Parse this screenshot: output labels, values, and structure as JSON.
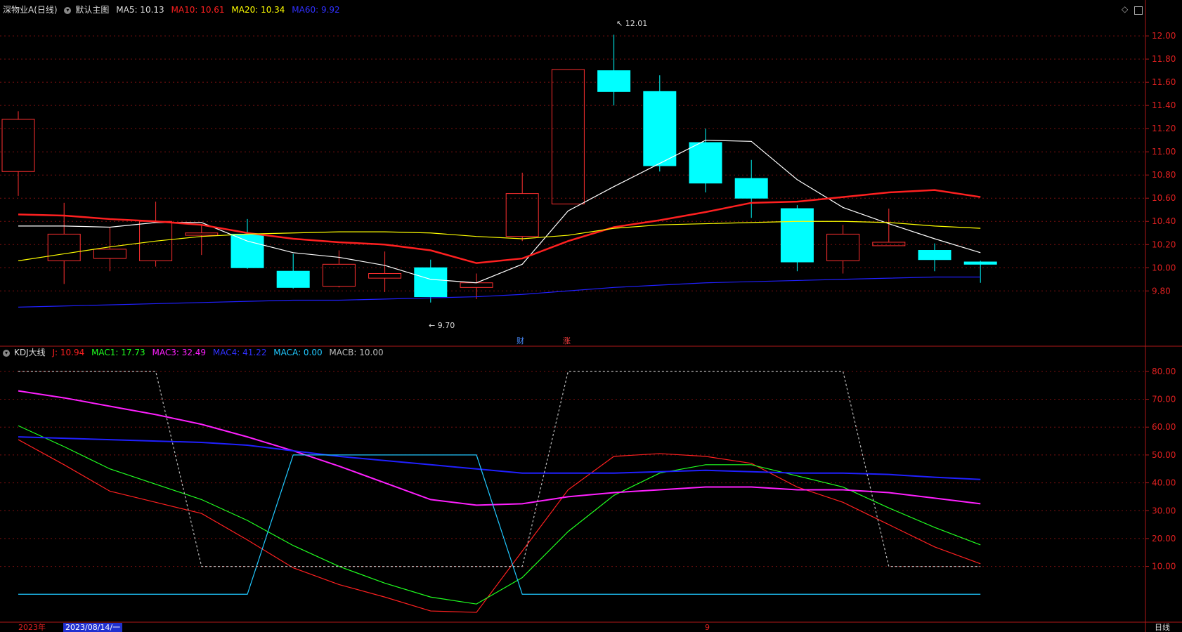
{
  "main_header": {
    "title": "深物业A(日线)",
    "template": "默认主图",
    "ma5": "MA5: 10.13",
    "ma10": "MA10: 10.61",
    "ma20": "MA20: 10.34",
    "ma60": "MA60: 9.92",
    "colors": {
      "ma5": "#ffffff",
      "ma10": "#ff2020",
      "ma20": "#ffff00",
      "ma60": "#2020ff"
    }
  },
  "kdj_header": {
    "title": "KDJ大线",
    "j": "J: 10.94",
    "mac1": "MAC1: 17.73",
    "mac3": "MAC3: 32.49",
    "mac4": "MAC4: 41.22",
    "maca": "MACA: 0.00",
    "macb": "MACB: 10.00"
  },
  "annotations": {
    "high": "12.01",
    "low": "9.70",
    "badge_finance": "财",
    "badge_rise": "涨"
  },
  "top_icons": [
    "diamond-icon",
    "window-icon"
  ],
  "x_axis": {
    "year": "2023年",
    "cursor_date": "2023/08/14/一",
    "month": "9",
    "period": "日线"
  },
  "chart_data": [
    {
      "type": "candlestick",
      "title": "深物业A(日线)",
      "y_ticks": [
        "12.00",
        "11.80",
        "11.60",
        "11.40",
        "11.20",
        "11.00",
        "10.80",
        "10.60",
        "10.40",
        "10.20",
        "10.00",
        "9.80"
      ],
      "ylim": [
        9.62,
        12.14
      ],
      "candles": [
        {
          "o": 10.83,
          "h": 11.35,
          "l": 10.62,
          "c": 11.28
        },
        {
          "o": 10.06,
          "h": 10.56,
          "l": 9.86,
          "c": 10.29
        },
        {
          "o": 10.08,
          "h": 10.35,
          "l": 9.97,
          "c": 10.16
        },
        {
          "o": 10.06,
          "h": 10.57,
          "l": 10.01,
          "c": 10.4
        },
        {
          "o": 10.28,
          "h": 10.37,
          "l": 10.11,
          "c": 10.3
        },
        {
          "o": 10.29,
          "h": 10.42,
          "l": 9.99,
          "c": 10.0
        },
        {
          "o": 9.97,
          "h": 10.12,
          "l": 9.82,
          "c": 9.83
        },
        {
          "o": 9.84,
          "h": 10.15,
          "l": 9.83,
          "c": 10.03
        },
        {
          "o": 9.91,
          "h": 10.14,
          "l": 9.79,
          "c": 9.95
        },
        {
          "o": 10.0,
          "h": 10.07,
          "l": 9.7,
          "c": 9.75
        },
        {
          "o": 9.83,
          "h": 9.95,
          "l": 9.73,
          "c": 9.87
        },
        {
          "o": 10.27,
          "h": 10.82,
          "l": 10.23,
          "c": 10.64
        },
        {
          "o": 10.55,
          "h": 11.71,
          "l": 10.55,
          "c": 11.71
        },
        {
          "o": 11.7,
          "h": 12.01,
          "l": 11.4,
          "c": 11.52
        },
        {
          "o": 11.52,
          "h": 11.66,
          "l": 10.83,
          "c": 10.88
        },
        {
          "o": 11.08,
          "h": 11.2,
          "l": 10.65,
          "c": 10.73
        },
        {
          "o": 10.77,
          "h": 10.93,
          "l": 10.43,
          "c": 10.6
        },
        {
          "o": 10.51,
          "h": 10.54,
          "l": 9.97,
          "c": 10.05
        },
        {
          "o": 10.06,
          "h": 10.37,
          "l": 9.95,
          "c": 10.29
        },
        {
          "o": 10.19,
          "h": 10.51,
          "l": 10.19,
          "c": 10.22
        },
        {
          "o": 10.15,
          "h": 10.21,
          "l": 9.97,
          "c": 10.07
        },
        {
          "o": 10.05,
          "h": 10.06,
          "l": 9.87,
          "c": 10.03
        }
      ],
      "series": [
        {
          "name": "MA5",
          "color": "#ffffff",
          "values": [
            10.36,
            10.36,
            10.35,
            10.39,
            10.39,
            10.23,
            10.13,
            10.09,
            10.02,
            9.9,
            9.87,
            10.03,
            10.49,
            10.7,
            10.9,
            11.1,
            11.09,
            10.76,
            10.52,
            10.38,
            10.25,
            10.13
          ]
        },
        {
          "name": "MA10",
          "color": "#ff2020",
          "values": [
            10.46,
            10.45,
            10.42,
            10.4,
            10.37,
            10.3,
            10.25,
            10.22,
            10.2,
            10.15,
            10.04,
            10.08,
            10.23,
            10.35,
            10.41,
            10.48,
            10.56,
            10.57,
            10.61,
            10.65,
            10.67,
            10.61
          ]
        },
        {
          "name": "MA20",
          "color": "#ffff00",
          "values": [
            10.06,
            10.12,
            10.18,
            10.23,
            10.27,
            10.29,
            10.3,
            10.31,
            10.31,
            10.3,
            10.27,
            10.25,
            10.28,
            10.34,
            10.37,
            10.38,
            10.39,
            10.4,
            10.4,
            10.39,
            10.36,
            10.34
          ]
        },
        {
          "name": "MA60",
          "color": "#2020ff",
          "values": [
            9.66,
            9.67,
            9.68,
            9.69,
            9.7,
            9.71,
            9.72,
            9.72,
            9.73,
            9.74,
            9.75,
            9.77,
            9.8,
            9.83,
            9.85,
            9.87,
            9.88,
            9.89,
            9.9,
            9.91,
            9.92,
            9.92
          ]
        }
      ]
    },
    {
      "type": "line",
      "title": "KDJ大线",
      "y_ticks": [
        "80.00",
        "70.00",
        "60.00",
        "50.00",
        "40.00",
        "30.00",
        "20.00",
        "10.00"
      ],
      "ylim": [
        -8.5,
        83.5
      ],
      "series": [
        {
          "name": "J",
          "color": "#ff2020",
          "values": [
            55.5,
            46.5,
            37,
            33,
            29,
            19.5,
            9.5,
            3.5,
            -1,
            -6,
            -6.5,
            15.5,
            37.5,
            49.5,
            50.5,
            49.5,
            47,
            38.5,
            33,
            25,
            17,
            10.94
          ]
        },
        {
          "name": "MAC1",
          "color": "#20ff20",
          "values": [
            60.5,
            53,
            45,
            39.5,
            34,
            26.5,
            17.5,
            10,
            4,
            -1,
            -3.5,
            6,
            22.5,
            35.5,
            43.5,
            46.5,
            46.5,
            42.5,
            38.5,
            31,
            24,
            17.73
          ]
        },
        {
          "name": "MAC3",
          "color": "#ff20ff",
          "values": [
            73,
            70.5,
            67.5,
            64.5,
            61,
            56.5,
            51.5,
            46,
            40,
            34,
            32,
            32.5,
            35,
            36.5,
            37.5,
            38.5,
            38.5,
            37.5,
            37.5,
            36.5,
            34.5,
            32.49
          ]
        },
        {
          "name": "MAC4",
          "color": "#2020ff",
          "values": [
            56.5,
            56,
            55.5,
            55,
            54.5,
            53.5,
            51.5,
            49.5,
            48,
            46.5,
            45,
            43.5,
            43.5,
            43.5,
            44,
            44.5,
            44,
            43.5,
            43.5,
            43,
            42,
            41.22
          ]
        },
        {
          "name": "MACA",
          "color": "#20c8ff",
          "values": [
            0,
            0,
            0,
            0,
            0,
            0,
            50,
            50,
            50,
            50,
            50,
            0,
            0,
            0,
            0,
            0,
            0,
            0,
            0,
            0,
            0,
            0.0
          ]
        },
        {
          "name": "MACB",
          "color": "#bbbbbb",
          "values": [
            80,
            80,
            80,
            80,
            10,
            10,
            10,
            10,
            10,
            10,
            10,
            10,
            80,
            80,
            80,
            80,
            80,
            80,
            80,
            10,
            10,
            10.0
          ]
        }
      ]
    }
  ]
}
